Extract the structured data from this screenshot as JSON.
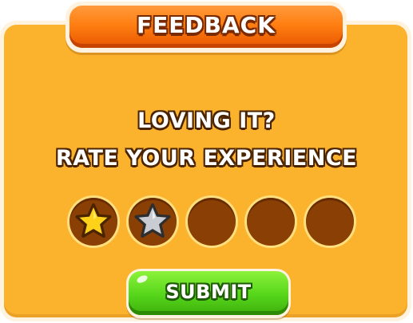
{
  "dialog": {
    "title": "FEEDBACK",
    "prompt_line1": "LOVING IT?",
    "prompt_line2": "RATE YOUR EXPERIENCE",
    "submit_label": "SUBMIT"
  },
  "rating": {
    "max_stars": 5,
    "value": 1,
    "hovered_star": 2,
    "stars": [
      {
        "state": "filled",
        "icon": "star-icon"
      },
      {
        "state": "hover",
        "icon": "star-icon"
      },
      {
        "state": "empty",
        "icon": null
      },
      {
        "state": "empty",
        "icon": null
      },
      {
        "state": "empty",
        "icon": null
      }
    ]
  },
  "colors": {
    "panel": "#fbb22d",
    "title_banner": "#ff7f12",
    "star_filled": "#ffd21a",
    "star_hover": "#c9cdd3",
    "slot_empty": "#8a3f04",
    "submit": "#55d61a"
  }
}
